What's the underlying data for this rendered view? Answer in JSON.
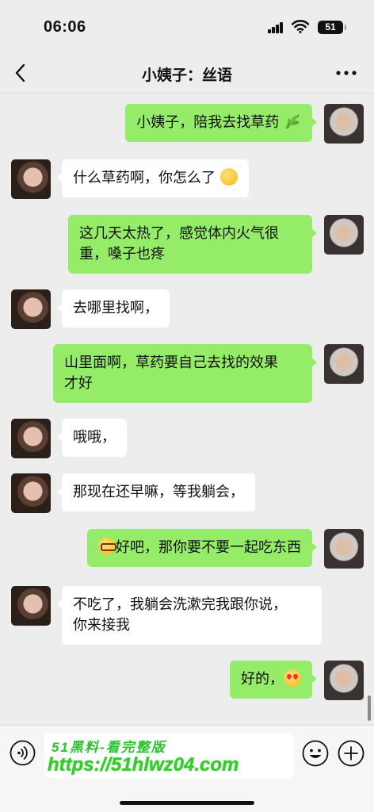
{
  "status_bar": {
    "time": "06:06",
    "battery": "51"
  },
  "nav": {
    "title": "小姨子：丝语"
  },
  "messages": [
    {
      "side": "right",
      "text": "小姨子，陪我去找草药",
      "emoji": "herb-emoji"
    },
    {
      "side": "left",
      "text": "什么草药啊，你怎么了",
      "emoji": "flushed-face-emoji"
    },
    {
      "side": "right",
      "line1": "这几天太热了，感觉体内火气很",
      "line2": "重，嗓子也疼"
    },
    {
      "side": "left",
      "text": "去哪里找啊，"
    },
    {
      "side": "right",
      "line1": "山里面啊，草药要自己去找的效果",
      "line2": "才好"
    },
    {
      "side": "left",
      "text": "哦哦，"
    },
    {
      "side": "left",
      "text": "那现在还早嘛，等我躺会，"
    },
    {
      "side": "right",
      "text": "好吧，那你要不要一起吃东西",
      "emoji": "nerd-face-emoji"
    },
    {
      "side": "left",
      "line1": "不吃了，我躺会洗漱完我跟你说，",
      "line2": "你来接我"
    },
    {
      "side": "right",
      "text": "好的，",
      "emoji": "heart-eyes-emoji"
    }
  ],
  "input_bar": {
    "watermark_line1": "51黑料-看完整版",
    "watermark_line2": "https://51hlwz04.com"
  },
  "colors": {
    "background": "#ededed",
    "sent_bubble": "#95ec69",
    "received_bubble": "#ffffff",
    "watermark": "#2fd126"
  }
}
